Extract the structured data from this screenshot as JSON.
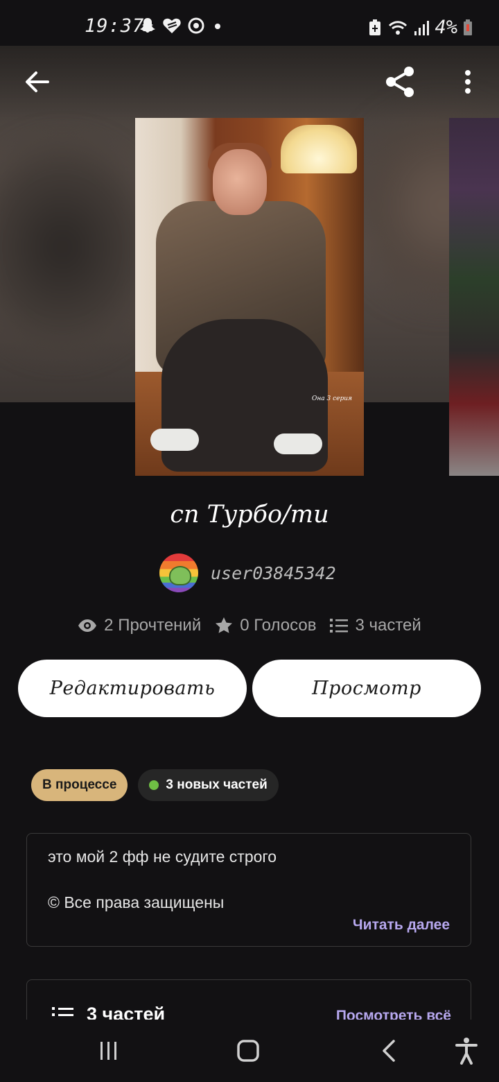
{
  "status_bar": {
    "time": "19:37",
    "battery": "4%",
    "left_icons": [
      "snapchat-icon",
      "heart-message-icon",
      "sync-icon",
      "dot-icon"
    ],
    "right_icons": [
      "battery-saver-icon",
      "wifi-icon",
      "signal-icon",
      "battery-low-icon"
    ]
  },
  "header": {
    "back_icon": "arrow-left-icon",
    "share_icon": "share-icon",
    "more_icon": "more-vertical-icon"
  },
  "story": {
    "title": "сп Турбо/ти",
    "author": "user03845342",
    "cover_caption": "Она 3 серия"
  },
  "stats": {
    "reads": "2 Прочтений",
    "votes": "0 Голосов",
    "parts": "3 частей"
  },
  "actions": {
    "edit": "Редактировать",
    "preview": "Просмотр"
  },
  "badges": {
    "status": "В процессе",
    "new_parts": "3 новых частей"
  },
  "description": {
    "line1": "это мой 2 фф не судите строго",
    "line2": "© Все права защищены",
    "read_more": "Читать далее"
  },
  "parts_section": {
    "title": "3 частей",
    "see_all": "Посмотреть всё"
  },
  "colors": {
    "background": "#121113",
    "accent": "#b7a8ef",
    "status_badge": "#d8b57b",
    "new_dot": "#6fbf44"
  },
  "nav_bar": {
    "recents_icon": "recents-icon",
    "home_icon": "home-icon",
    "back_icon": "back-chevron-icon",
    "accessibility_icon": "accessibility-icon"
  }
}
